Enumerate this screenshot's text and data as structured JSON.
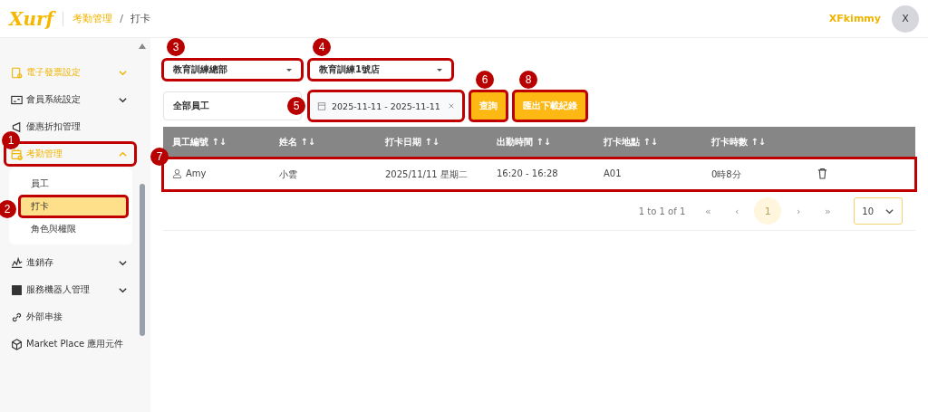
{
  "header": {
    "logo": "Xurf",
    "breadcrumb": [
      {
        "label": "考勤管理",
        "selected": false
      },
      {
        "label": "打卡",
        "selected": true
      }
    ],
    "separator": "/",
    "user": "XFkimmy",
    "avatar": "X"
  },
  "sidebar": {
    "items": [
      {
        "label": "電子發票設定",
        "active": true,
        "expanded": false
      },
      {
        "label": "會員系統設定",
        "active": false,
        "expanded": false
      },
      {
        "label": "優惠折扣管理",
        "active": false
      },
      {
        "label": "考勤管理",
        "active": true,
        "expanded": true,
        "outlined": true,
        "callout": "1",
        "children": [
          {
            "label": "員工",
            "selected": false,
            "outlined": false
          },
          {
            "label": "打卡",
            "selected": true,
            "outlined": true,
            "callout": "2"
          },
          {
            "label": "角色與權限",
            "selected": false,
            "outlined": false
          }
        ]
      },
      {
        "label": "進銷存",
        "active": false,
        "expanded": false
      },
      {
        "label": "服務機器人管理",
        "active": false,
        "expanded": false
      },
      {
        "label": "外部串接",
        "active": false
      },
      {
        "label": "Market Place 應用元件",
        "active": false
      }
    ]
  },
  "filters": {
    "department": {
      "value": "教育訓練總部",
      "outlined": true,
      "callout": "3"
    },
    "store": {
      "value": "教育訓練1號店",
      "outlined": true,
      "callout": "4"
    },
    "employee": {
      "value": "全部員工"
    },
    "date_range": {
      "value": "2025-11-11 - 2025-11-11",
      "outlined": true,
      "callout": "5"
    },
    "buttons": [
      {
        "label": "查詢",
        "outlined": true,
        "callout": "6"
      },
      {
        "label": "匯出下載紀錄",
        "outlined": true,
        "callout": "8"
      }
    ]
  },
  "table": {
    "columns": [
      "員工編號 ↑↓",
      "姓名 ↑↓",
      "打卡日期 ↑↓",
      "出勤時間 ↑↓",
      "打卡地點 ↑↓",
      "打卡時數 ↑↓"
    ],
    "rows": [
      {
        "cells": [
          "Amy",
          "小雲",
          "2025/11/11 星期二",
          "16:20 - 16:28",
          "A01",
          "0時8分"
        ],
        "outlined": true,
        "callout": "7"
      }
    ]
  },
  "pagination": {
    "summary": "1 to 1 of 1",
    "first": "«",
    "prev": "‹",
    "pages": [
      {
        "label": "1",
        "selected": true
      }
    ],
    "next": "›",
    "last": "»",
    "page_size": "10"
  }
}
